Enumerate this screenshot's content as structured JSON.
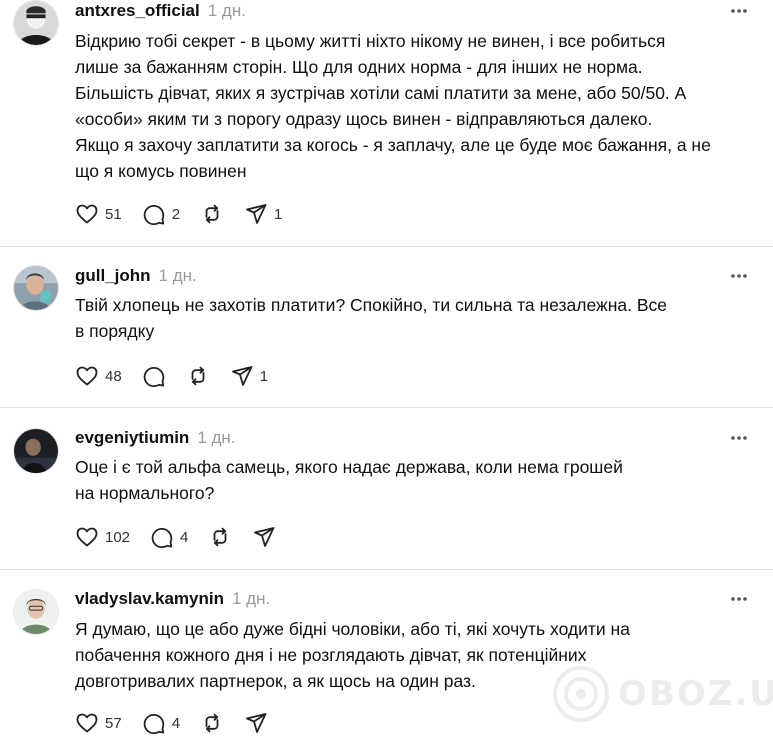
{
  "posts": [
    {
      "username": "antxres_official",
      "time": "1 дн.",
      "lines": [
        "Відкрию тобі секрет - в цьому житті ніхто нікому не винен, і все робиться",
        "лише за бажанням сторін. Що для одних норма - для інших не норма.",
        "Більшість дівчат, яких я зустрічав хотіли самі платити за мене, або 50/50. А",
        "«особи» яким ти з порогу одразу щось винен - відправляються далеко.",
        "Якщо я захочу заплатити за когось - я заплачу, але це буде моє бажання, а не",
        "що я комусь повинен"
      ],
      "likes": "51",
      "replies": "2",
      "reposts": "",
      "shares": "1"
    },
    {
      "username": "gull_john",
      "time": "1 дн.",
      "lines": [
        "Твій хлопець не захотів платити? Спокійно, ти сильна та незалежна. Все",
        "в порядку"
      ],
      "likes": "48",
      "replies": "",
      "reposts": "",
      "shares": "1"
    },
    {
      "username": "evgeniytiumin",
      "time": "1 дн.",
      "lines": [
        "Оце і є той альфа самець, якого надає держава, коли нема грошей",
        "на нормального?"
      ],
      "likes": "102",
      "replies": "4",
      "reposts": "",
      "shares": ""
    },
    {
      "username": "vladyslav.kamynin",
      "time": "1 дн.",
      "lines": [
        "Я думаю, що це або дуже бідні чоловіки, або ті, які хочуть ходити на",
        "побачення кожного дня і не розглядають дівчат, як потенційних",
        "довготривалих партнерок, а як щось на один раз."
      ],
      "likes": "57",
      "replies": "4",
      "reposts": "",
      "shares": ""
    }
  ],
  "watermark": "OBOZ.UA",
  "icons": {
    "like": "heart-icon",
    "reply": "comment-icon",
    "repost": "repost-icon",
    "share": "send-icon",
    "more": "more-icon"
  }
}
